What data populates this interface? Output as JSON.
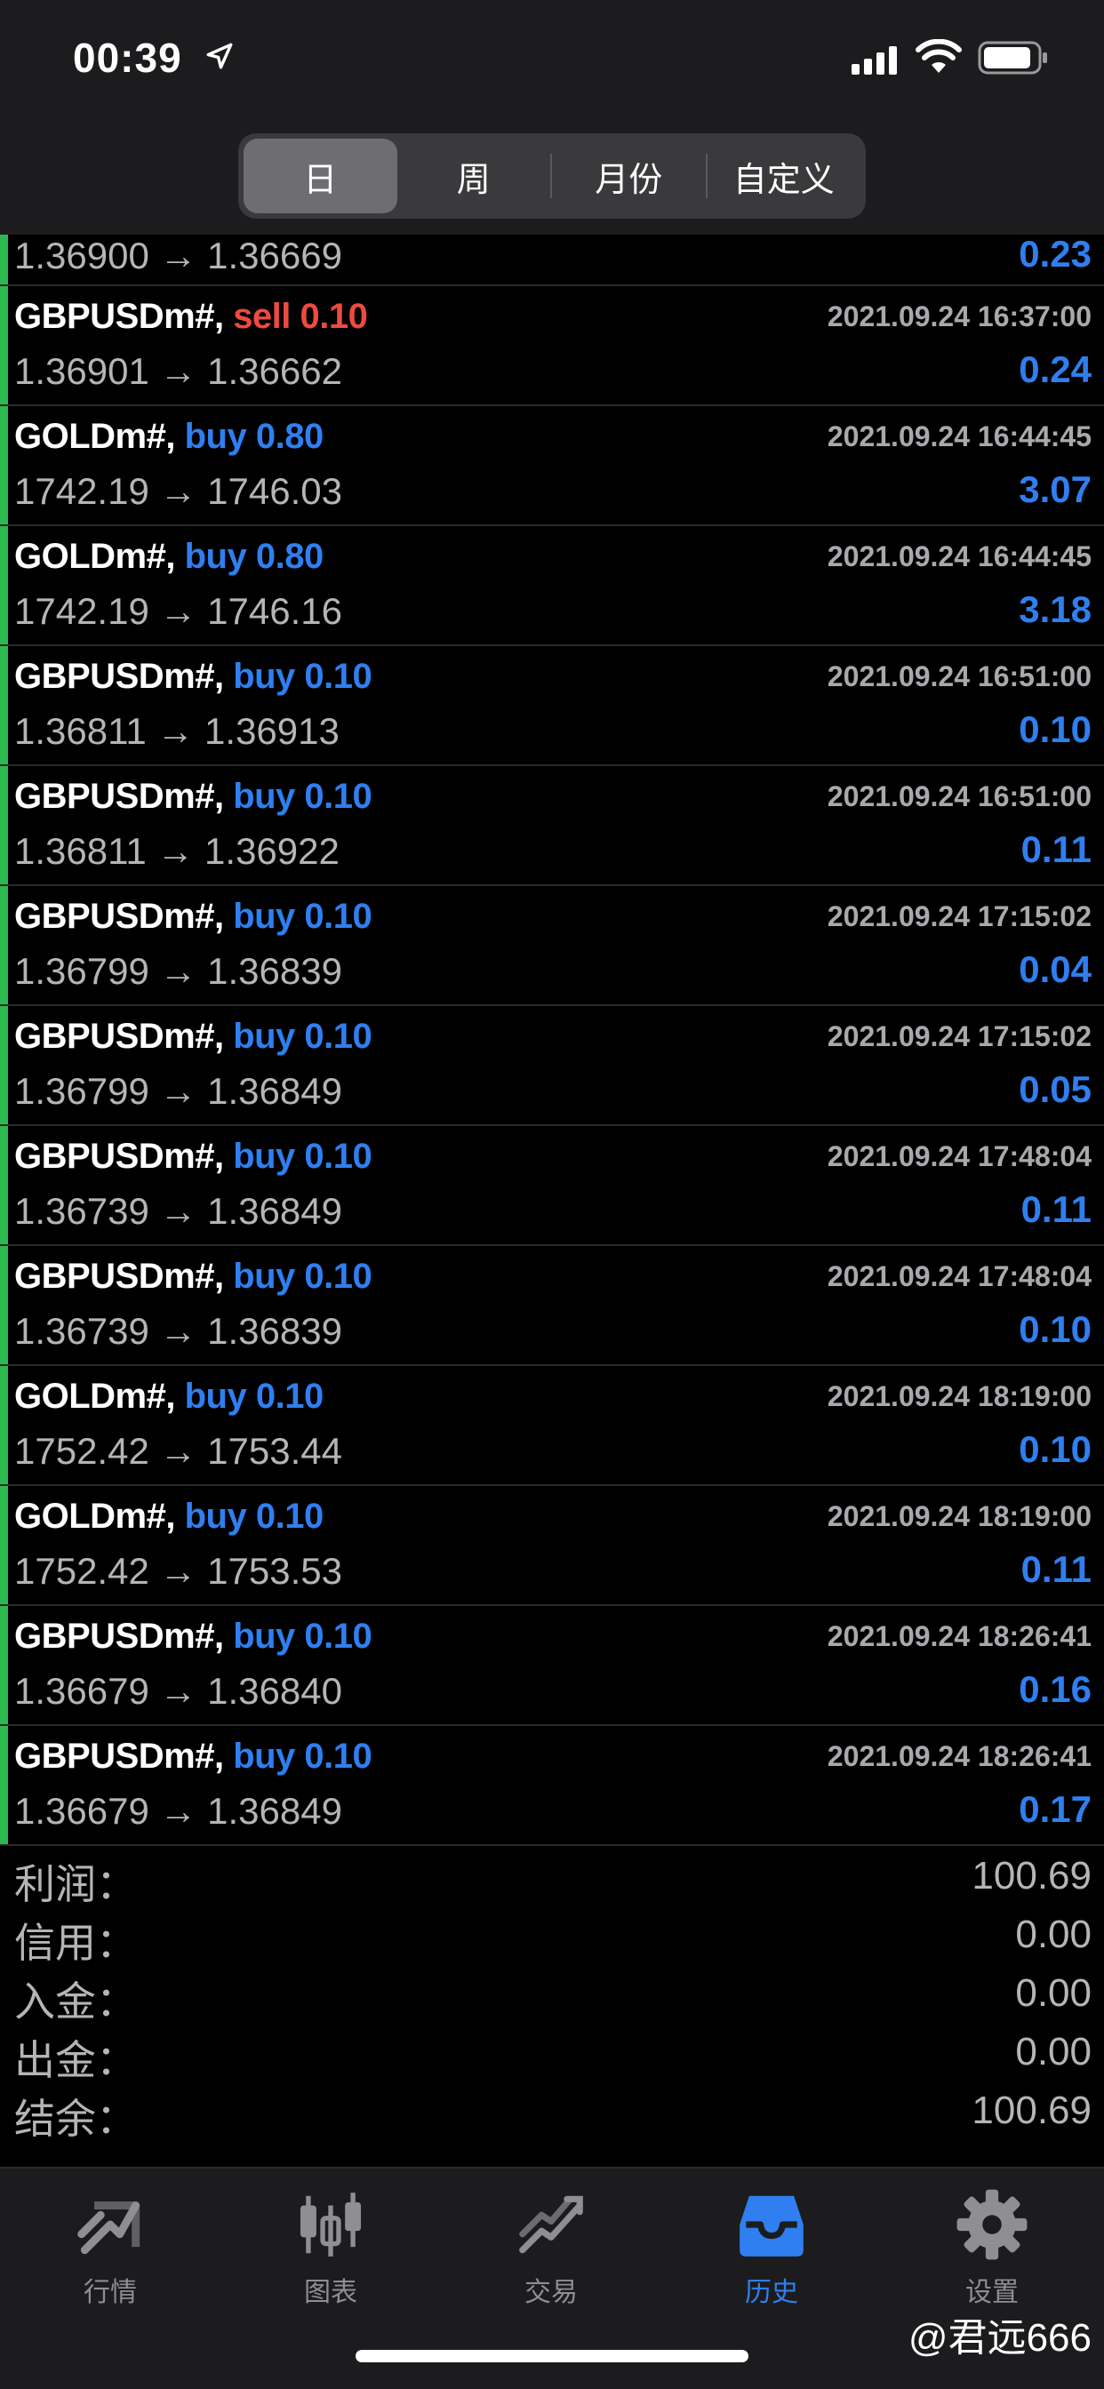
{
  "status_bar": {
    "time": "00:39"
  },
  "period_tabs": [
    {
      "label": "日",
      "active": true
    },
    {
      "label": "周",
      "active": false
    },
    {
      "label": "月份",
      "active": false
    },
    {
      "label": "自定义",
      "active": false
    }
  ],
  "first_row": {
    "prices": "1.36900 → 1.36669",
    "profit": "0.23"
  },
  "trades": [
    {
      "symbol": "GBPUSDm#,",
      "side": "sell 0.10",
      "type": "sell",
      "date": "2021.09.24 16:37:00",
      "prices": "1.36901 → 1.36662",
      "profit": "0.24"
    },
    {
      "symbol": "GOLDm#,",
      "side": "buy 0.80",
      "type": "buy",
      "date": "2021.09.24 16:44:45",
      "prices": "1742.19 → 1746.03",
      "profit": "3.07"
    },
    {
      "symbol": "GOLDm#,",
      "side": "buy 0.80",
      "type": "buy",
      "date": "2021.09.24 16:44:45",
      "prices": "1742.19 → 1746.16",
      "profit": "3.18"
    },
    {
      "symbol": "GBPUSDm#,",
      "side": "buy 0.10",
      "type": "buy",
      "date": "2021.09.24 16:51:00",
      "prices": "1.36811 → 1.36913",
      "profit": "0.10"
    },
    {
      "symbol": "GBPUSDm#,",
      "side": "buy 0.10",
      "type": "buy",
      "date": "2021.09.24 16:51:00",
      "prices": "1.36811 → 1.36922",
      "profit": "0.11"
    },
    {
      "symbol": "GBPUSDm#,",
      "side": "buy 0.10",
      "type": "buy",
      "date": "2021.09.24 17:15:02",
      "prices": "1.36799 → 1.36839",
      "profit": "0.04"
    },
    {
      "symbol": "GBPUSDm#,",
      "side": "buy 0.10",
      "type": "buy",
      "date": "2021.09.24 17:15:02",
      "prices": "1.36799 → 1.36849",
      "profit": "0.05"
    },
    {
      "symbol": "GBPUSDm#,",
      "side": "buy 0.10",
      "type": "buy",
      "date": "2021.09.24 17:48:04",
      "prices": "1.36739 → 1.36849",
      "profit": "0.11"
    },
    {
      "symbol": "GBPUSDm#,",
      "side": "buy 0.10",
      "type": "buy",
      "date": "2021.09.24 17:48:04",
      "prices": "1.36739 → 1.36839",
      "profit": "0.10"
    },
    {
      "symbol": "GOLDm#,",
      "side": "buy 0.10",
      "type": "buy",
      "date": "2021.09.24 18:19:00",
      "prices": "1752.42 → 1753.44",
      "profit": "0.10"
    },
    {
      "symbol": "GOLDm#,",
      "side": "buy 0.10",
      "type": "buy",
      "date": "2021.09.24 18:19:00",
      "prices": "1752.42 → 1753.53",
      "profit": "0.11"
    },
    {
      "symbol": "GBPUSDm#,",
      "side": "buy 0.10",
      "type": "buy",
      "date": "2021.09.24 18:26:41",
      "prices": "1.36679 → 1.36840",
      "profit": "0.16"
    },
    {
      "symbol": "GBPUSDm#,",
      "side": "buy 0.10",
      "type": "buy",
      "date": "2021.09.24 18:26:41",
      "prices": "1.36679 → 1.36849",
      "profit": "0.17"
    }
  ],
  "summary": [
    {
      "label": "利润：",
      "value": "100.69"
    },
    {
      "label": "信用：",
      "value": "0.00"
    },
    {
      "label": "入金：",
      "value": "0.00"
    },
    {
      "label": "出金：",
      "value": "0.00"
    },
    {
      "label": "结余：",
      "value": "100.69"
    }
  ],
  "tabbar": [
    {
      "label": "行情",
      "icon": "quotes-icon",
      "active": false
    },
    {
      "label": "图表",
      "icon": "chart-icon",
      "active": false
    },
    {
      "label": "交易",
      "icon": "trade-icon",
      "active": false
    },
    {
      "label": "历史",
      "icon": "history-icon",
      "active": true
    },
    {
      "label": "设置",
      "icon": "settings-icon",
      "active": false
    }
  ],
  "watermark": "@君远666",
  "colors": {
    "buy": "#2f7ff0",
    "sell": "#ec4b40",
    "accent_bar": "#2fb84f",
    "tab_active": "#2f7ff0"
  }
}
